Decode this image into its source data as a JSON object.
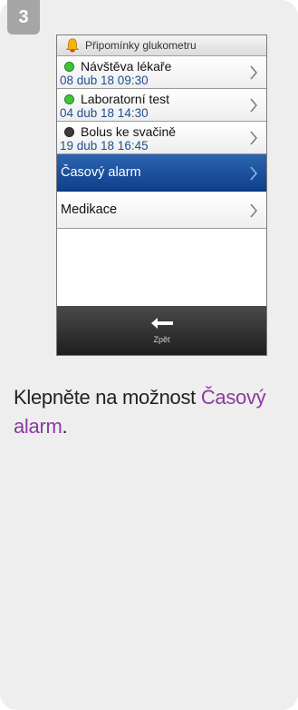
{
  "step": {
    "number": "3"
  },
  "screen": {
    "title": "Připomínky glukometru",
    "items": [
      {
        "title": "Návštěva lékaře",
        "datetime": "08 dub 18 09:30",
        "dot_color": "#3cc63c"
      },
      {
        "title": "Laboratorní test",
        "datetime": "04 dub 18 14:30",
        "dot_color": "#3cc63c"
      },
      {
        "title": "Bolus ke svačině",
        "datetime": "19 dub 18 16:45",
        "dot_color": "#3a3a3a"
      }
    ],
    "menu": [
      {
        "label": "Časový alarm",
        "selected": true
      },
      {
        "label": "Medikace",
        "selected": false
      }
    ],
    "footer": {
      "back_label": "Zpět"
    }
  },
  "instruction": {
    "prefix": "Klepněte na možnost ",
    "highlight": "Časový alarm",
    "suffix": "."
  },
  "colors": {
    "selected_bg": "#1c4f9c",
    "highlight_text": "#8b3aa0",
    "date_text": "#1f4f8f"
  }
}
